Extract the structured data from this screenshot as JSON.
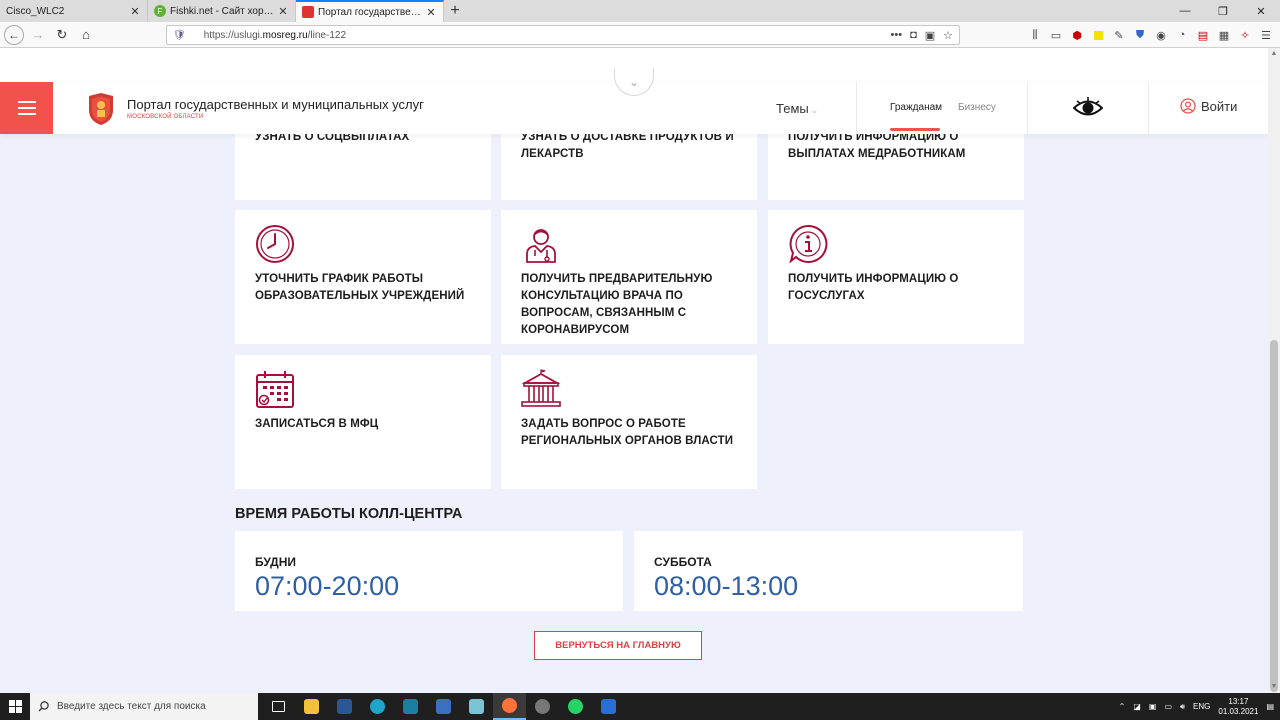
{
  "browser": {
    "tabs": [
      {
        "title": "Cisco_WLC2",
        "active": false,
        "favicon": "none"
      },
      {
        "title": "Fishki.net - Сайт хорошего на",
        "active": false,
        "favicon": "fishki-icon"
      },
      {
        "title": "Портал государственных и му",
        "active": true,
        "favicon": "mosreg-icon"
      }
    ],
    "url_prefix": "https://uslugi.",
    "url_domain": "mosreg.ru",
    "url_path": "/line-122",
    "url_icons": [
      "more-icon",
      "pocket-icon",
      "translate-icon",
      "bookmark-star-icon"
    ]
  },
  "header": {
    "site_title": "Портал государственных и муниципальных услуг",
    "site_subtitle": "МОСКОВСКОЙ ОБЛАСТИ",
    "themes_label": "Темы",
    "tab_citizens": "Гражданам",
    "tab_business": "Бизнесу",
    "login_label": "Войти",
    "brand_color": "#f2524c"
  },
  "cards": [
    {
      "label": "УЗНАТЬ О СОЦВЫПЛАТАХ",
      "icon": "none"
    },
    {
      "label": "УЗНАТЬ О ДОСТАВКЕ ПРОДУКТОВ И ЛЕКАРСТВ",
      "icon": "none"
    },
    {
      "label": "ПОЛУЧИТЬ ИНФОРМАЦИЮ О ВЫПЛАТАХ МЕДРАБОТНИКАМ",
      "icon": "none"
    },
    {
      "label": "УТОЧНИТЬ ГРАФИК РАБОТЫ ОБРАЗОВАТЕЛЬНЫХ УЧРЕЖДЕНИЙ",
      "icon": "clock-icon"
    },
    {
      "label": "ПОЛУЧИТЬ ПРЕДВАРИТЕЛЬНУЮ КОНСУЛЬТАЦИЮ ВРАЧА ПО ВОПРОСАМ, СВЯЗАННЫМ С КОРОНАВИРУСОМ",
      "icon": "doctor-icon"
    },
    {
      "label": "ПОЛУЧИТЬ ИНФОРМАЦИЮ О ГОСУСЛУГАХ",
      "icon": "info-bubble-icon"
    },
    {
      "label": "ЗАПИСАТЬСЯ В МФЦ",
      "icon": "calendar-icon"
    },
    {
      "label": "ЗАДАТЬ ВОПРОС О РАБОТЕ РЕГИОНАЛЬНЫХ ОРГАНОВ ВЛАСТИ",
      "icon": "government-building-icon"
    }
  ],
  "callcenter": {
    "title": "ВРЕМЯ РАБОТЫ КОЛЛ-ЦЕНТРА",
    "weekdays_label": "БУДНИ",
    "weekdays_time": "07:00-20:00",
    "saturday_label": "СУББОТА",
    "saturday_time": "08:00-13:00",
    "time_color": "#2f5fa7"
  },
  "back_button": "ВЕРНУТЬСЯ НА ГЛАВНУЮ",
  "taskbar": {
    "search_placeholder": "Введите здесь текст для поиска",
    "lang": "ENG",
    "time": "13:17",
    "date": "01.03.2021"
  }
}
